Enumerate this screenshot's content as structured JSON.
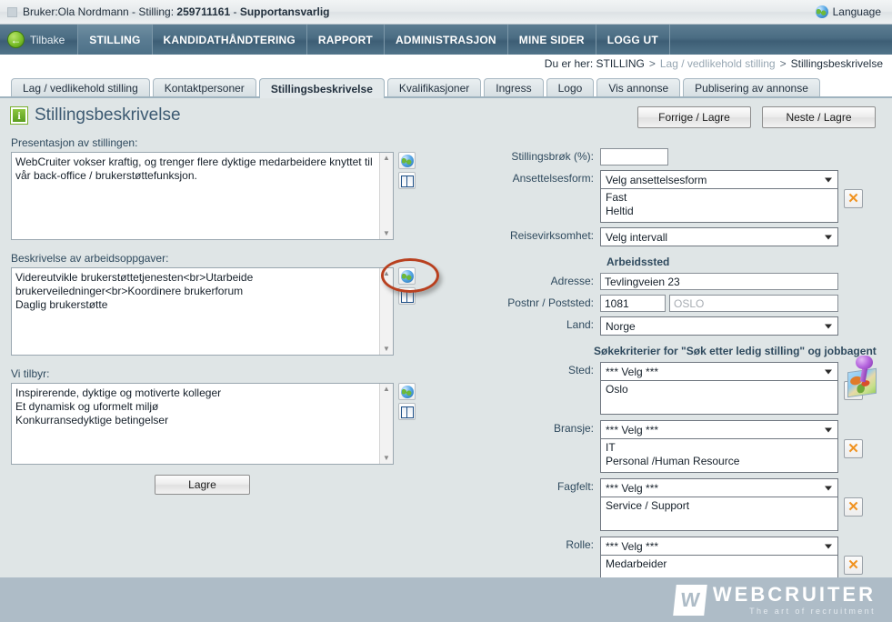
{
  "userbar": {
    "prefix": "Bruker:Ola Nordmann - Stilling: ",
    "job_id": "259711161",
    "dash": " - ",
    "job_title": "Supportansvarlig",
    "language_label": "Language"
  },
  "nav": {
    "back_label": "Tilbake",
    "items": [
      {
        "label": "STILLING",
        "active": true
      },
      {
        "label": "KANDIDATHÅNDTERING",
        "active": false
      },
      {
        "label": "RAPPORT",
        "active": false
      },
      {
        "label": "ADMINISTRASJON",
        "active": false
      },
      {
        "label": "MINE SIDER",
        "active": false
      },
      {
        "label": "LOGG UT",
        "active": false
      }
    ]
  },
  "breadcrumb": {
    "prefix": "Du er her: STILLING",
    "sep1": ">",
    "middle": "Lag / vedlikehold stilling",
    "sep2": ">",
    "last": "Stillingsbeskrivelse"
  },
  "tabs": [
    {
      "label": "Lag / vedlikehold stilling",
      "active": false
    },
    {
      "label": "Kontaktpersoner",
      "active": false
    },
    {
      "label": "Stillingsbeskrivelse",
      "active": true
    },
    {
      "label": "Kvalifikasjoner",
      "active": false
    },
    {
      "label": "Ingress",
      "active": false
    },
    {
      "label": "Logo",
      "active": false
    },
    {
      "label": "Vis annonse",
      "active": false
    },
    {
      "label": "Publisering av annonse",
      "active": false
    }
  ],
  "page": {
    "title": "Stillingsbeskrivelse",
    "info_glyph": "i",
    "prev_button": "Forrige / Lagre",
    "next_button": "Neste / Lagre",
    "save_button": "Lagre"
  },
  "left": {
    "presentation": {
      "label": "Presentasjon av stillingen:",
      "value": "WebCruiter vokser kraftig, og trenger flere dyktige medarbeidere knyttet til vår back-office / brukerstøttefunksjon."
    },
    "tasks": {
      "label": "Beskrivelse av arbeidsoppgaver:",
      "value": "Videreutvikle brukerstøttetjenesten<br>Utarbeide brukerveiledninger<br>Koordinere brukerforum\nDaglig brukerstøtte"
    },
    "offer": {
      "label": "Vi tilbyr:",
      "value": "Inspirerende, dyktige og motiverte kolleger\nEt dynamisk og uformelt miljø\nKonkurransedyktige betingelser"
    },
    "icons": {
      "translate": "globe-icon",
      "dictionary": "book-icon"
    },
    "scroll_up": "▲",
    "scroll_down": "▼"
  },
  "right": {
    "stillingsbrok": {
      "label": "Stillingsbrøk (%):",
      "value": ""
    },
    "ansettelsesform": {
      "label": "Ansettelsesform:",
      "selected": "Velg ansettelsesform",
      "chosen": [
        "Fast",
        "Heltid"
      ]
    },
    "reisevirksomhet": {
      "label": "Reisevirksomhet:",
      "selected": "Velg intervall"
    },
    "arbeidssted_heading": "Arbeidssted",
    "adresse": {
      "label": "Adresse:",
      "value": "Tevlingveien 23"
    },
    "postnr": {
      "label": "Postnr / Poststed:",
      "value": "1081",
      "poststed_placeholder": "OSLO"
    },
    "land": {
      "label": "Land:",
      "selected": "Norge"
    },
    "sok_heading": "Søkekriterier for \"Søk etter ledig stilling\" og jobbagent",
    "sted": {
      "label": "Sted:",
      "selected": "*** Velg ***",
      "chosen": [
        "Oslo"
      ]
    },
    "bransje": {
      "label": "Bransje:",
      "selected": "*** Velg ***",
      "chosen": [
        "IT",
        "Personal /Human Resource"
      ]
    },
    "fagfelt": {
      "label": "Fagfelt:",
      "selected": "*** Velg ***",
      "chosen": [
        "Service / Support"
      ]
    },
    "rolle": {
      "label": "Rolle:",
      "selected": "*** Velg ***",
      "chosen": [
        "Medarbeider"
      ]
    },
    "delete_glyph": "✕"
  },
  "footer": {
    "logo_mark": "W",
    "logo_name": "WEBCRUITER",
    "logo_tagline": "The art of recruitment"
  },
  "colors": {
    "nav_bg": "#4a6c83",
    "content_bg": "#dfe5e6",
    "footer_bg": "#aebcc7",
    "label_text": "#2f4a5e",
    "title_text": "#3d5a72",
    "annotation": "#b8401f",
    "delete_icon": "#f0921f"
  }
}
